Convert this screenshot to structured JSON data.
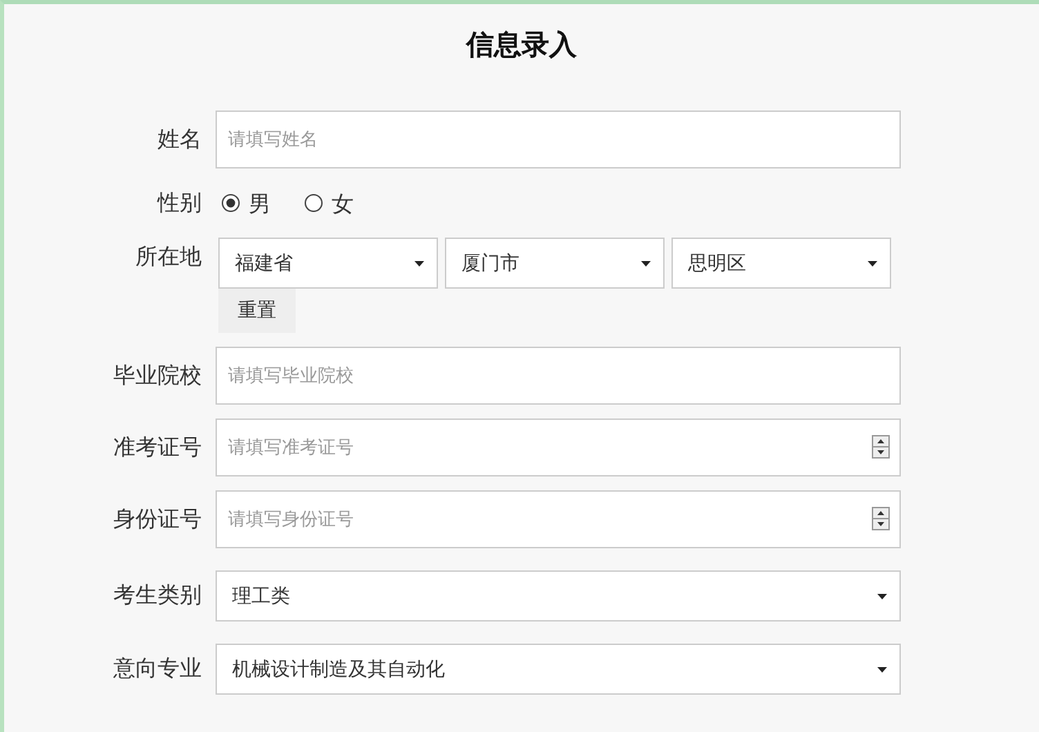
{
  "title": "信息录入",
  "fields": [
    {
      "kind": "text",
      "label": "姓名",
      "placeholder": "请填写姓名"
    },
    {
      "kind": "radio",
      "label": "性别",
      "options": [
        {
          "label": "男",
          "selected": true
        },
        {
          "label": "女",
          "selected": false
        }
      ]
    },
    {
      "kind": "location",
      "label": "所在地",
      "selects": [
        "福建省",
        "厦门市",
        "思明区"
      ],
      "button": "重置"
    },
    {
      "kind": "text",
      "label": "毕业院校",
      "placeholder": "请填写毕业院校"
    },
    {
      "kind": "number",
      "label": "准考证号",
      "placeholder": "请填写准考证号"
    },
    {
      "kind": "number",
      "label": "身份证号",
      "placeholder": "请填写身份证号"
    },
    {
      "kind": "select",
      "label": "考生类别",
      "value": "理工类"
    },
    {
      "kind": "select",
      "label": "意向专业",
      "value": "机械设计制造及其自动化"
    }
  ]
}
